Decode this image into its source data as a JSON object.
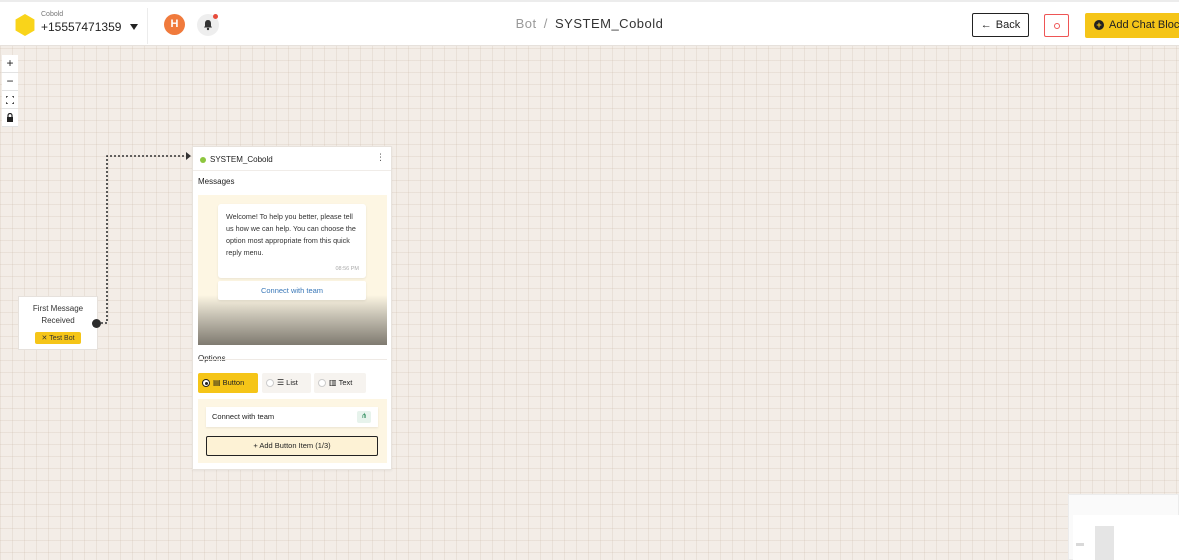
{
  "header": {
    "account_name": "Cobold",
    "account_phone": "+15557471359",
    "avatar_initial": "H",
    "breadcrumb_parent": "Bot",
    "breadcrumb_separator": "/",
    "breadcrumb_current": "SYSTEM_Cobold",
    "back_label": "Back",
    "add_chat_block_label": "Add Chat Block"
  },
  "zoom_controls": {
    "zoom_in": "+",
    "zoom_out": "−",
    "fit": "⛶",
    "lock": "🔒"
  },
  "start_node": {
    "title": "First Message Received",
    "test_bot_label": "Test Bot",
    "test_bot_icon": "✕"
  },
  "block": {
    "title": "SYSTEM_Cobold",
    "messages_label": "Messages",
    "message_text": "Welcome! To help you better, please tell us how we can help. You can choose the option most appropriate from this quick reply menu.",
    "message_time": "08:56 PM",
    "quick_reply": "Connect with team",
    "options_label": "Options",
    "options": [
      {
        "label": "Button",
        "icon": "▤",
        "selected": true
      },
      {
        "label": "List",
        "icon": "☰",
        "selected": false
      },
      {
        "label": "Text",
        "icon": "▥",
        "selected": false
      }
    ],
    "button_items": [
      {
        "label": "Connect with team",
        "icon": "bot-flow-icon"
      }
    ],
    "add_button_label": "+   Add Button Item (1/3)"
  },
  "colors": {
    "accent": "#f5c518",
    "canvas": "#f3ede7",
    "link": "#3a78b8",
    "status_dot": "#8dc63f",
    "avatar": "#f07a3c"
  }
}
